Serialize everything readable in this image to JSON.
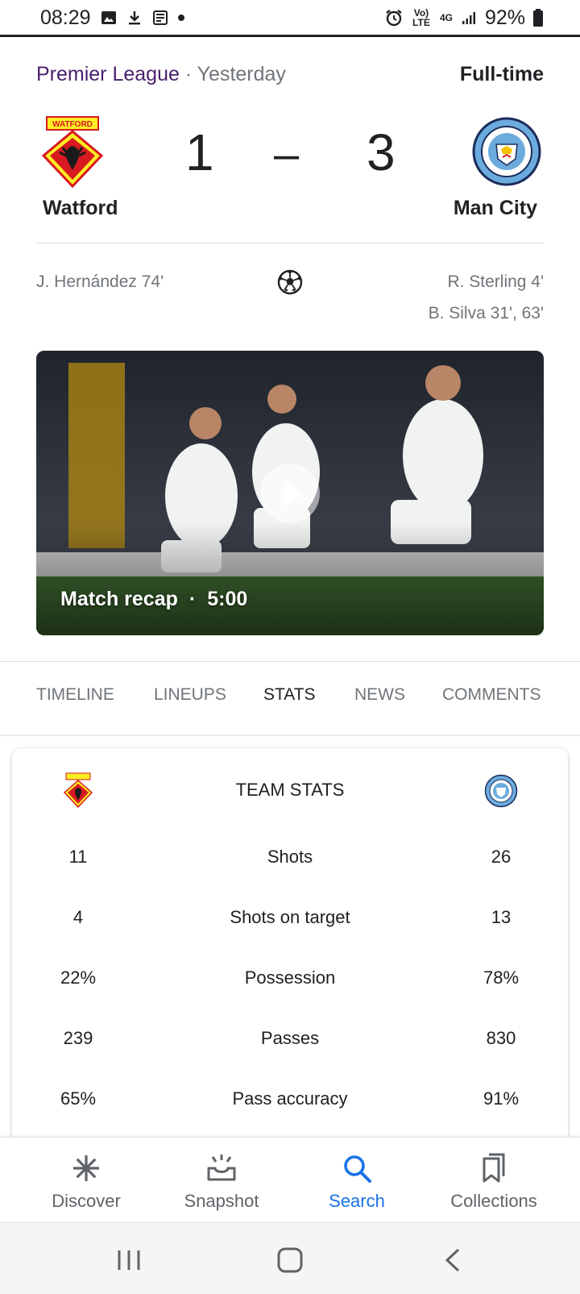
{
  "status_bar": {
    "time": "08:29",
    "battery": "92%",
    "network": "4G",
    "volte": "Vo) LTE"
  },
  "header": {
    "league": "Premier League",
    "separator": " · ",
    "when": "Yesterday",
    "status": "Full-time"
  },
  "match": {
    "home": {
      "name": "Watford",
      "score": "1",
      "crest": "watford-crest"
    },
    "away": {
      "name": "Man City",
      "score": "3",
      "crest": "man-city-crest"
    },
    "dash": "–"
  },
  "scorers": {
    "home": [
      "J. Hernández 74'"
    ],
    "away": [
      "R. Sterling 4'",
      "B. Silva 31', 63'"
    ]
  },
  "video": {
    "title": "Match recap",
    "dot": "·",
    "duration": "5:00"
  },
  "tabs": [
    {
      "label": "TIMELINE",
      "active": false
    },
    {
      "label": "LINEUPS",
      "active": false
    },
    {
      "label": "STATS",
      "active": true
    },
    {
      "label": "NEWS",
      "active": false
    },
    {
      "label": "COMMENTS",
      "active": false
    }
  ],
  "team_stats": {
    "title": "TEAM STATS",
    "rows": [
      {
        "label": "Shots",
        "home": "11",
        "away": "26"
      },
      {
        "label": "Shots on target",
        "home": "4",
        "away": "13"
      },
      {
        "label": "Possession",
        "home": "22%",
        "away": "78%"
      },
      {
        "label": "Passes",
        "home": "239",
        "away": "830"
      },
      {
        "label": "Pass accuracy",
        "home": "65%",
        "away": "91%"
      }
    ]
  },
  "bottom_nav": [
    {
      "label": "Discover",
      "icon": "asterisk-icon",
      "active": false
    },
    {
      "label": "Snapshot",
      "icon": "snapshot-icon",
      "active": false
    },
    {
      "label": "Search",
      "icon": "search-icon",
      "active": true
    },
    {
      "label": "Collections",
      "icon": "bookmarks-icon",
      "active": false
    }
  ],
  "colors": {
    "league": "#4a1f6b",
    "accent": "#1a73e8",
    "muted": "#70757a",
    "text": "#202124"
  }
}
